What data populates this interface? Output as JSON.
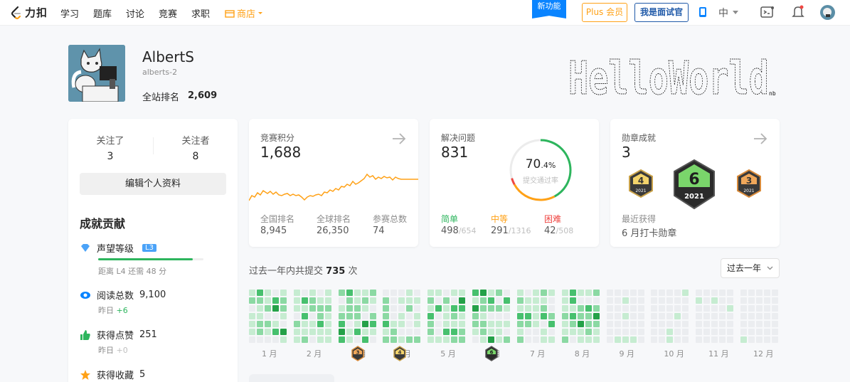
{
  "nav": {
    "logo_text": "力扣",
    "items": [
      "学习",
      "题库",
      "讨论",
      "竞赛",
      "求职"
    ],
    "shop": "商店",
    "new_feature": "新功能",
    "plus": "Plus 会员",
    "interviewer": "我是面试官",
    "lang": "中"
  },
  "profile": {
    "name": "AlbertS",
    "id": "alberts-2",
    "rank_label": "全站排名",
    "rank": "2,609",
    "banner_text": "HelloWorld",
    "banner_sub": "nb"
  },
  "follow": {
    "following_label": "关注了",
    "following": "3",
    "followers_label": "关注者",
    "followers": "8",
    "edit": "编辑个人资料"
  },
  "contrib": {
    "title": "成就贡献",
    "reputation_label": "声望等级",
    "reputation_badge": "L3",
    "reputation_progress": 0.9,
    "reputation_sub": "距离 L4 还需 48 分",
    "reads_label": "阅读总数",
    "reads": "9,100",
    "reads_sub_prefix": "昨日",
    "reads_sub": "+6",
    "likes_label": "获得点赞",
    "likes": "251",
    "likes_sub_prefix": "昨日",
    "likes_sub": "+0",
    "fav_label": "获得收藏",
    "fav": "5"
  },
  "contest": {
    "title": "竞赛积分",
    "score": "1,688",
    "national_label": "全国排名",
    "national": "8,945",
    "global_label": "全球排名",
    "global": "26,350",
    "attended_label": "参赛总数",
    "attended": "74"
  },
  "solved": {
    "title": "解决问题",
    "count": "831",
    "rate_main": "70",
    "rate_frac": ".4%",
    "rate_label": "提交通过率",
    "rate": 70.4,
    "easy_label": "简单",
    "easy": "498",
    "easy_total": "/654",
    "medium_label": "中等",
    "medium": "291",
    "medium_total": "/1316",
    "hard_label": "困难",
    "hard": "42",
    "hard_total": "/508",
    "colors": {
      "easy": "#2db55d",
      "medium": "#ffa116",
      "hard": "#ef4743"
    }
  },
  "badges": {
    "title": "勋章成就",
    "count": "3",
    "recent_label": "最近获得",
    "recent": "6 月打卡勋章",
    "items": [
      {
        "num": "4",
        "year": "2021"
      },
      {
        "num": "6",
        "year": "2021"
      },
      {
        "num": "3",
        "year": "2021"
      }
    ]
  },
  "heatmap": {
    "summary_prefix": "过去一年内共提交",
    "summary_count": "735",
    "summary_suffix": "次",
    "range": "过去一年",
    "months": [
      "1 月",
      "2 月",
      "3 月",
      "4 月",
      "5 月",
      "6 月",
      "7 月",
      "8 月",
      "9 月",
      "10 月",
      "11 月",
      "12 月"
    ],
    "month_badges": [
      {
        "num": "3"
      },
      {
        "num": "4"
      },
      {
        "num": "6"
      }
    ]
  }
}
